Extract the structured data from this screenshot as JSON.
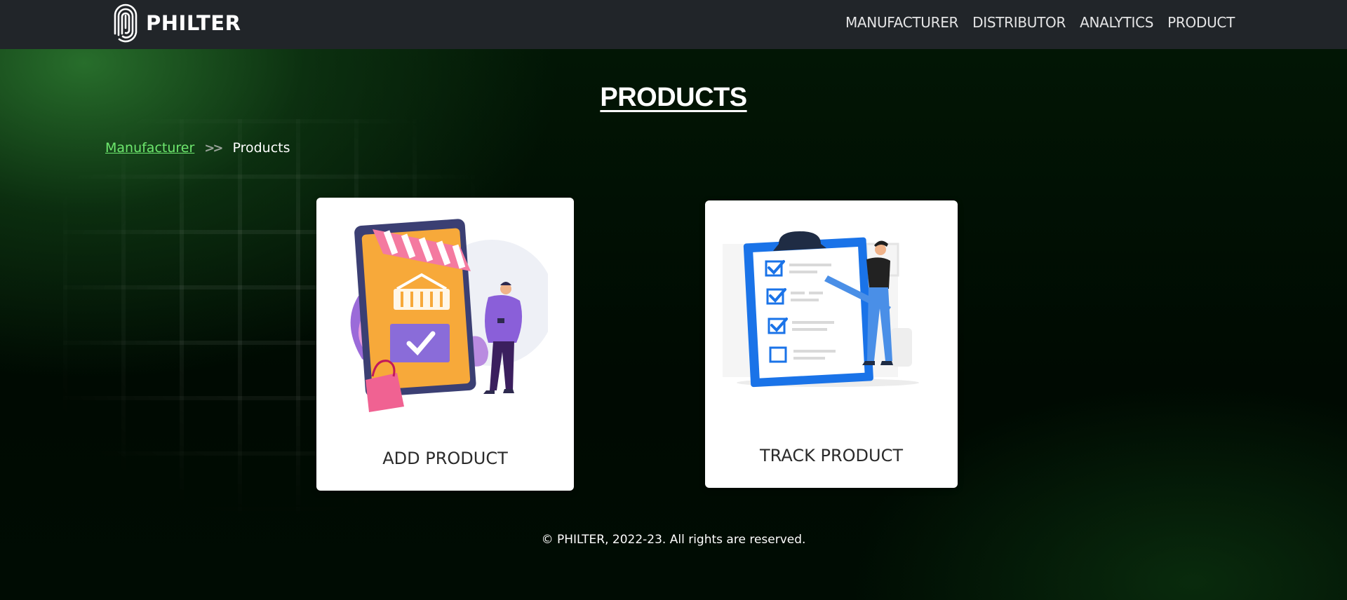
{
  "navbar": {
    "brand": "PHILTER",
    "links": [
      "MANUFACTURER",
      "DISTRIBUTOR",
      "ANALYTICS",
      "PRODUCT"
    ]
  },
  "page": {
    "title": "PRODUCTS"
  },
  "breadcrumb": {
    "parent": "Manufacturer",
    "separator_icon": "double-chevron-right-icon",
    "current": "Products"
  },
  "cards": [
    {
      "label": "ADD PRODUCT",
      "illustration": "online-shop-illustration"
    },
    {
      "label": "TRACK PRODUCT",
      "illustration": "checklist-clipboard-illustration"
    }
  ],
  "footer": {
    "text": "© PHILTER, 2022-23. All rights are reserved."
  },
  "colors": {
    "navbar": "#212529",
    "breadcrumb_link": "#6ee86e",
    "accent_blue": "#1a73e8"
  }
}
